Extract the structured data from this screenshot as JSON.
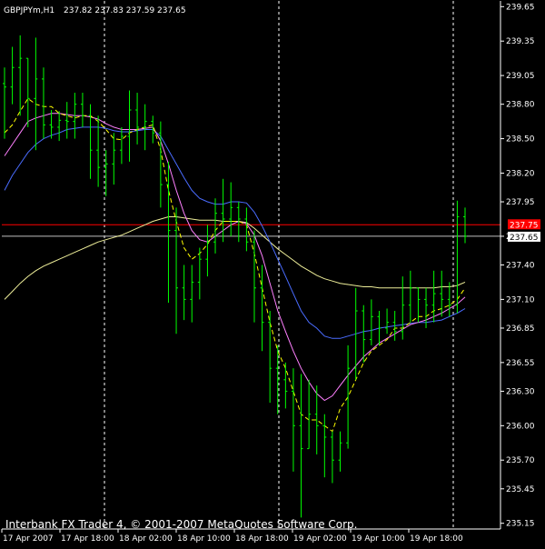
{
  "header": {
    "symbol_timeframe": "GBPJPYm,H1",
    "ohlc": "237.82 237.83 237.59 237.65"
  },
  "footer": {
    "copyright": "Interbank FX Trader 4, © 2001-2007 MetaQuotes Software Corp."
  },
  "colors": {
    "background": "#000000",
    "bars": "#00ff00",
    "axis": "#ffffff",
    "separator": "#ffffff",
    "ma_fast": "#ffff00",
    "ma_mid": "#ff80ff",
    "ma_slow": "#4a6cff",
    "ma_long": "#eeee99",
    "ask_line": "#ff0000",
    "ask_label_bg": "#ff0000",
    "bid_line": "#c0c0c0",
    "bid_label_bg": "#ffffff"
  },
  "price_labels": {
    "ask": "237.75",
    "bid": "237.65"
  },
  "chart_data": {
    "type": "candlestick-bar",
    "title": "GBPJPYm,H1",
    "ylim": [
      235.1,
      239.7
    ],
    "y_ticks": [
      "239.65",
      "239.35",
      "239.05",
      "238.80",
      "238.50",
      "238.20",
      "237.95",
      "237.65",
      "237.40",
      "237.10",
      "236.85",
      "236.55",
      "236.30",
      "236.00",
      "235.70",
      "235.45",
      "235.15"
    ],
    "x_ticks": [
      "17 Apr 2007",
      "17 Apr 18:00",
      "18 Apr 02:00",
      "18 Apr 10:00",
      "18 Apr 18:00",
      "19 Apr 02:00",
      "19 Apr 10:00",
      "19 Apr 18:00"
    ],
    "ask": 237.75,
    "bid": 237.65,
    "bars": [
      {
        "o": 238.98,
        "h": 239.12,
        "l": 238.5,
        "c": 238.95
      },
      {
        "o": 238.95,
        "h": 239.3,
        "l": 238.8,
        "c": 239.12
      },
      {
        "o": 239.12,
        "h": 239.4,
        "l": 238.7,
        "c": 239.2
      },
      {
        "o": 239.2,
        "h": 239.2,
        "l": 238.6,
        "c": 238.85
      },
      {
        "o": 238.85,
        "h": 239.38,
        "l": 238.4,
        "c": 239.02
      },
      {
        "o": 239.02,
        "h": 239.12,
        "l": 238.5,
        "c": 238.62
      },
      {
        "o": 238.62,
        "h": 238.75,
        "l": 238.5,
        "c": 238.6
      },
      {
        "o": 238.6,
        "h": 238.74,
        "l": 238.48,
        "c": 238.66
      },
      {
        "o": 238.66,
        "h": 238.82,
        "l": 238.5,
        "c": 238.65
      },
      {
        "o": 238.65,
        "h": 238.9,
        "l": 238.5,
        "c": 238.8
      },
      {
        "o": 238.8,
        "h": 238.9,
        "l": 238.6,
        "c": 238.7
      },
      {
        "o": 238.7,
        "h": 238.8,
        "l": 238.15,
        "c": 238.4
      },
      {
        "o": 238.4,
        "h": 238.7,
        "l": 238.08,
        "c": 238.25
      },
      {
        "o": 238.25,
        "h": 238.4,
        "l": 238.0,
        "c": 238.28
      },
      {
        "o": 238.28,
        "h": 238.55,
        "l": 238.1,
        "c": 238.4
      },
      {
        "o": 238.4,
        "h": 238.6,
        "l": 238.28,
        "c": 238.52
      },
      {
        "o": 238.52,
        "h": 238.92,
        "l": 238.3,
        "c": 238.75
      },
      {
        "o": 238.75,
        "h": 238.9,
        "l": 238.45,
        "c": 238.6
      },
      {
        "o": 238.6,
        "h": 238.8,
        "l": 238.4,
        "c": 238.65
      },
      {
        "o": 238.65,
        "h": 238.7,
        "l": 238.46,
        "c": 238.55
      },
      {
        "o": 238.55,
        "h": 238.65,
        "l": 237.9,
        "c": 238.1
      },
      {
        "o": 238.1,
        "h": 238.3,
        "l": 237.07,
        "c": 237.7
      },
      {
        "o": 237.7,
        "h": 237.9,
        "l": 236.8,
        "c": 237.2
      },
      {
        "o": 237.2,
        "h": 237.4,
        "l": 236.92,
        "c": 237.1
      },
      {
        "o": 237.1,
        "h": 237.4,
        "l": 236.9,
        "c": 237.25
      },
      {
        "o": 237.25,
        "h": 237.55,
        "l": 237.1,
        "c": 237.45
      },
      {
        "o": 237.45,
        "h": 237.75,
        "l": 237.3,
        "c": 237.6
      },
      {
        "o": 237.6,
        "h": 237.98,
        "l": 237.5,
        "c": 237.85
      },
      {
        "o": 237.85,
        "h": 238.15,
        "l": 237.6,
        "c": 237.8
      },
      {
        "o": 237.8,
        "h": 238.12,
        "l": 237.65,
        "c": 237.9
      },
      {
        "o": 237.9,
        "h": 237.95,
        "l": 237.6,
        "c": 237.8
      },
      {
        "o": 237.8,
        "h": 237.9,
        "l": 237.52,
        "c": 237.6
      },
      {
        "o": 237.6,
        "h": 237.7,
        "l": 236.9,
        "c": 237.2
      },
      {
        "o": 237.2,
        "h": 237.4,
        "l": 236.65,
        "c": 236.9
      },
      {
        "o": 236.9,
        "h": 237.0,
        "l": 236.2,
        "c": 236.5
      },
      {
        "o": 236.5,
        "h": 236.7,
        "l": 236.1,
        "c": 236.4
      },
      {
        "o": 236.4,
        "h": 236.55,
        "l": 236.15,
        "c": 236.3
      },
      {
        "o": 236.3,
        "h": 236.5,
        "l": 235.6,
        "c": 236.0
      },
      {
        "o": 236.0,
        "h": 236.45,
        "l": 235.2,
        "c": 235.8
      },
      {
        "o": 235.8,
        "h": 236.4,
        "l": 235.8,
        "c": 236.1
      },
      {
        "o": 236.1,
        "h": 236.35,
        "l": 235.75,
        "c": 236.0
      },
      {
        "o": 236.0,
        "h": 236.1,
        "l": 235.55,
        "c": 235.9
      },
      {
        "o": 235.9,
        "h": 235.95,
        "l": 235.5,
        "c": 235.7
      },
      {
        "o": 235.7,
        "h": 235.95,
        "l": 235.6,
        "c": 235.85
      },
      {
        "o": 235.85,
        "h": 236.7,
        "l": 235.8,
        "c": 236.5
      },
      {
        "o": 236.5,
        "h": 237.2,
        "l": 236.4,
        "c": 237.0
      },
      {
        "o": 237.0,
        "h": 237.05,
        "l": 236.55,
        "c": 236.75
      },
      {
        "o": 236.75,
        "h": 237.1,
        "l": 236.7,
        "c": 236.95
      },
      {
        "o": 236.95,
        "h": 237.0,
        "l": 236.7,
        "c": 236.85
      },
      {
        "o": 236.85,
        "h": 237.02,
        "l": 236.8,
        "c": 236.9
      },
      {
        "o": 236.9,
        "h": 237.0,
        "l": 236.74,
        "c": 236.82
      },
      {
        "o": 236.82,
        "h": 237.3,
        "l": 236.75,
        "c": 237.05
      },
      {
        "o": 237.05,
        "h": 237.35,
        "l": 236.9,
        "c": 237.2
      },
      {
        "o": 237.2,
        "h": 237.2,
        "l": 236.9,
        "c": 237.1
      },
      {
        "o": 237.1,
        "h": 237.2,
        "l": 236.85,
        "c": 237.05
      },
      {
        "o": 237.05,
        "h": 237.35,
        "l": 236.9,
        "c": 237.15
      },
      {
        "o": 237.15,
        "h": 237.35,
        "l": 236.95,
        "c": 237.1
      },
      {
        "o": 237.1,
        "h": 237.25,
        "l": 236.95,
        "c": 237.05
      },
      {
        "o": 237.05,
        "h": 237.96,
        "l": 236.98,
        "c": 237.82
      },
      {
        "o": 237.82,
        "h": 237.9,
        "l": 237.59,
        "c": 237.65
      }
    ],
    "ma_fast": [
      238.55,
      238.62,
      238.74,
      238.85,
      238.8,
      238.78,
      238.78,
      238.72,
      238.7,
      238.68,
      238.7,
      238.7,
      238.65,
      238.58,
      238.5,
      238.49,
      238.55,
      238.58,
      238.6,
      238.62,
      238.4,
      238.05,
      237.78,
      237.55,
      237.45,
      237.5,
      237.58,
      237.7,
      237.78,
      237.78,
      237.78,
      237.75,
      237.5,
      237.2,
      236.9,
      236.65,
      236.5,
      236.3,
      236.1,
      236.05,
      236.05,
      236.0,
      235.95,
      236.15,
      236.25,
      236.4,
      236.55,
      236.65,
      236.7,
      236.75,
      236.85,
      236.85,
      236.9,
      236.95,
      236.95,
      237.0,
      237.02,
      237.05,
      237.1,
      237.2
    ],
    "ma_mid": [
      238.35,
      238.45,
      238.55,
      238.65,
      238.68,
      238.7,
      238.72,
      238.72,
      238.71,
      238.7,
      238.7,
      238.69,
      238.67,
      238.63,
      238.6,
      238.58,
      238.58,
      238.58,
      238.59,
      238.6,
      238.48,
      238.28,
      238.05,
      237.85,
      237.7,
      237.62,
      237.6,
      237.65,
      237.7,
      237.75,
      237.78,
      237.76,
      237.66,
      237.48,
      237.24,
      237.0,
      236.82,
      236.65,
      236.5,
      236.38,
      236.28,
      236.22,
      236.26,
      236.35,
      236.44,
      236.52,
      236.6,
      236.66,
      236.72,
      236.76,
      236.8,
      236.84,
      236.88,
      236.9,
      236.92,
      236.95,
      236.98,
      237.02,
      237.06,
      237.12
    ],
    "ma_slow": [
      238.05,
      238.18,
      238.28,
      238.38,
      238.45,
      238.5,
      238.53,
      238.55,
      238.58,
      238.59,
      238.6,
      238.6,
      238.6,
      238.59,
      238.57,
      238.56,
      238.56,
      238.57,
      238.58,
      238.58,
      238.52,
      238.4,
      238.28,
      238.16,
      238.05,
      237.98,
      237.95,
      237.93,
      237.93,
      237.95,
      237.95,
      237.94,
      237.86,
      237.74,
      237.6,
      237.45,
      237.3,
      237.15,
      237.0,
      236.9,
      236.85,
      236.78,
      236.76,
      236.76,
      236.78,
      236.8,
      236.82,
      236.83,
      236.85,
      236.86,
      236.87,
      236.88,
      236.89,
      236.9,
      236.9,
      236.91,
      236.92,
      236.95,
      236.98,
      237.02
    ],
    "ma_long": [
      237.1,
      237.17,
      237.24,
      237.3,
      237.35,
      237.39,
      237.42,
      237.45,
      237.48,
      237.51,
      237.54,
      237.57,
      237.6,
      237.62,
      237.64,
      237.66,
      237.69,
      237.72,
      237.75,
      237.78,
      237.8,
      237.82,
      237.82,
      237.81,
      237.8,
      237.79,
      237.79,
      237.79,
      237.78,
      237.78,
      237.78,
      237.77,
      237.72,
      237.66,
      237.6,
      237.54,
      237.49,
      237.44,
      237.39,
      237.35,
      237.31,
      237.28,
      237.26,
      237.24,
      237.23,
      237.22,
      237.21,
      237.21,
      237.2,
      237.2,
      237.2,
      237.2,
      237.2,
      237.2,
      237.2,
      237.2,
      237.21,
      237.21,
      237.22,
      237.25
    ]
  }
}
